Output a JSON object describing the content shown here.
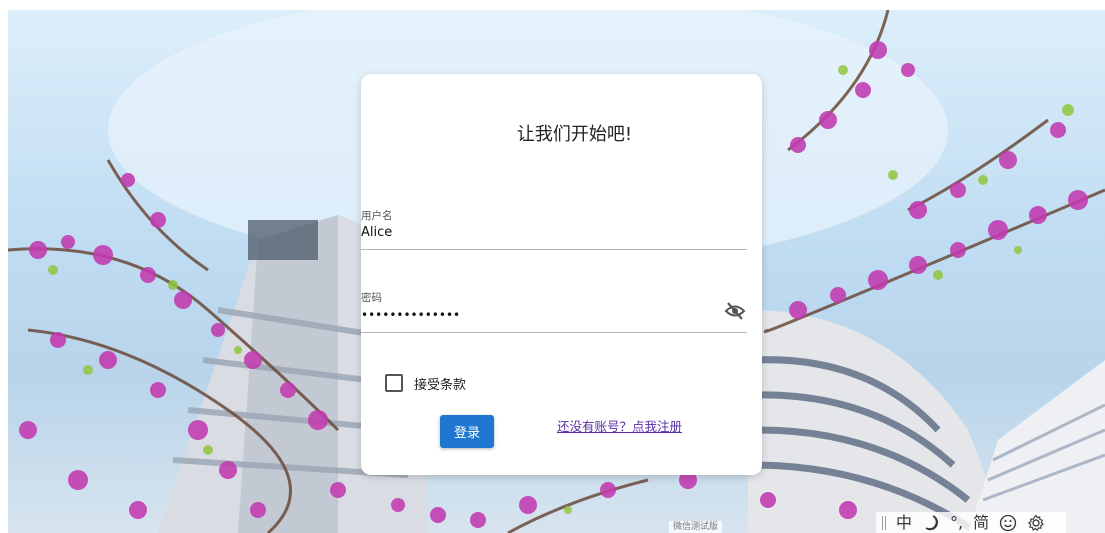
{
  "login": {
    "title": "让我们开始吧!",
    "username": {
      "label": "用户名",
      "value": "Alice"
    },
    "password": {
      "label": "密码",
      "value": "••••••••••••••",
      "visibility_icon": "eye-off-icon"
    },
    "terms": {
      "label": "接受条款",
      "checked": false
    },
    "login_button": "登录",
    "register_link": "还没有账号？点我注册"
  },
  "watermark": "微信测试版",
  "ime_toolbar": {
    "language": "中",
    "punctuation": "°,",
    "script": "简",
    "icons": [
      "moon-icon",
      "smiley-icon",
      "gear-icon"
    ]
  },
  "colors": {
    "primary": "#1e76d0",
    "link": "#5a2ea6",
    "card": "#ffffff"
  }
}
